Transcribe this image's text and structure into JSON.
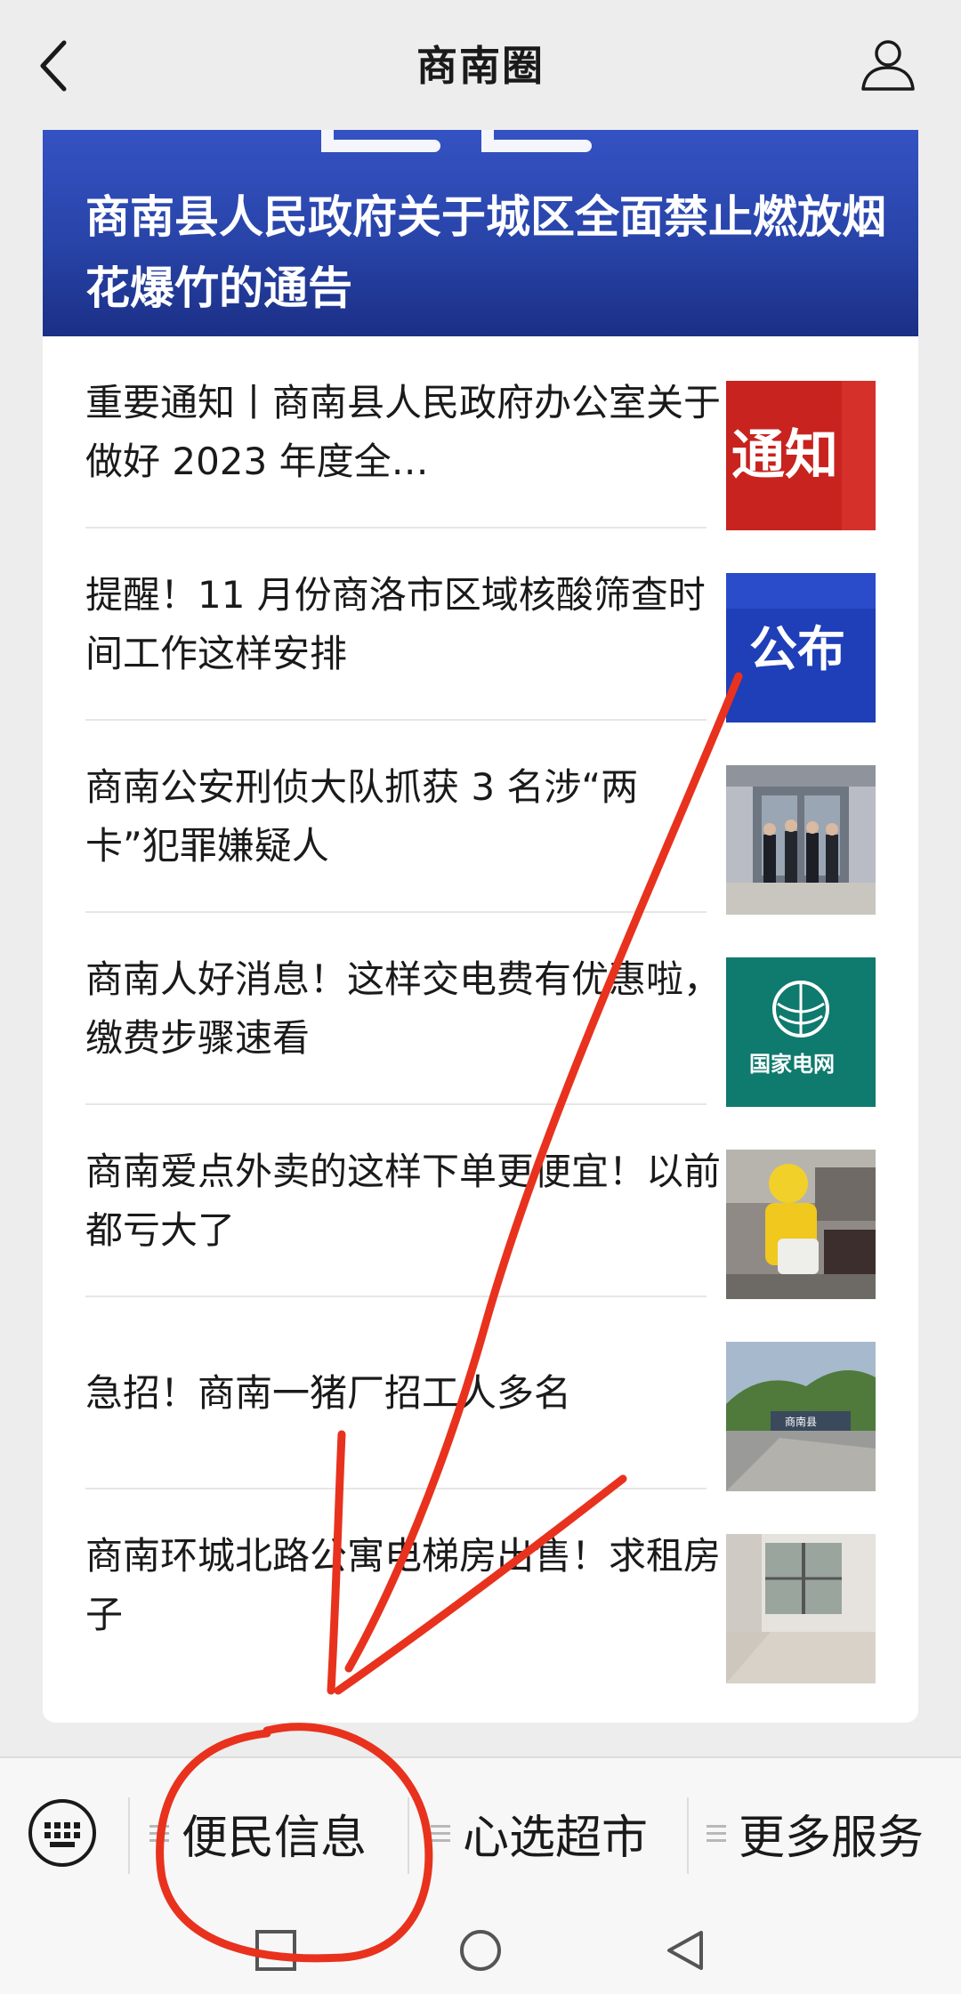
{
  "header": {
    "title": "商南圈",
    "back_icon": "chevron-left-icon",
    "profile_icon": "user-icon"
  },
  "banner": {
    "headline": "商南县人民政府关于城区全面禁止燃放烟花爆竹的通告",
    "color": "#2844a8"
  },
  "articles": [
    {
      "title": "重要通知丨商南县人民政府办公室关于做好 2023 年度全…",
      "thumb_text": "通知"
    },
    {
      "title": "提醒！11 月份商洛市区域核酸筛查时间工作这样安排",
      "thumb_text": "公布"
    },
    {
      "title": "商南公安刑侦大队抓获 3 名涉“两卡”犯罪嫌疑人",
      "thumb_text": ""
    },
    {
      "title": "商南人好消息！这样交电费有优惠啦，缴费步骤速看",
      "thumb_text": "国家电网"
    },
    {
      "title": "商南爱点外卖的这样下单更便宜！以前都亏大了",
      "thumb_text": ""
    },
    {
      "title": "急招！商南一猪厂招工人多名",
      "thumb_text": "商南县",
      "thumb_text_2": ""
    },
    {
      "title": "商南环城北路公寓电梯房出售！求租房子",
      "thumb_text": ""
    }
  ],
  "bottom_menu": {
    "keyboard_icon": "keyboard-icon",
    "items": [
      {
        "label": "便民信息"
      },
      {
        "label": "心选超市"
      },
      {
        "label": "更多服务"
      }
    ]
  },
  "system_nav": {
    "icons": [
      "recent-apps-icon",
      "home-icon",
      "back-triangle-icon"
    ]
  },
  "annotation": {
    "color": "#e8321e"
  }
}
